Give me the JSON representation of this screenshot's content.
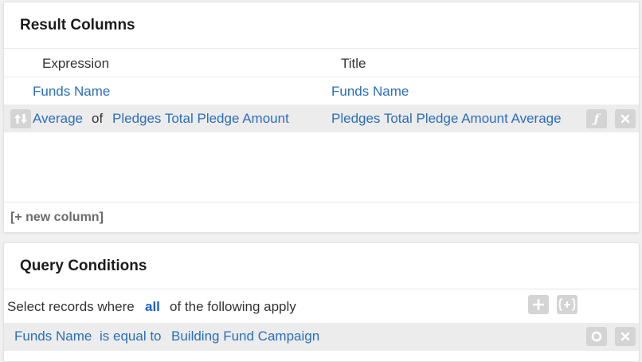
{
  "result_columns": {
    "title": "Result Columns",
    "headers": {
      "expression": "Expression",
      "title": "Title"
    },
    "rows": [
      {
        "expression": "Funds Name",
        "title": "Funds Name"
      },
      {
        "aggregate": "Average",
        "of": "of",
        "field": "Pledges Total Pledge Amount",
        "title": "Pledges Total Pledge Amount Average"
      }
    ],
    "new_column_label": "[+ new column]"
  },
  "query_conditions": {
    "title": "Query Conditions",
    "intro_prefix": "Select records where",
    "intro_match": "all",
    "intro_suffix": "of the following apply",
    "condition": {
      "field": "Funds Name",
      "operator": "is equal to",
      "value": "Building Fund Campaign"
    }
  },
  "icons": {
    "sort": "sort-arrows-icon",
    "function": "function-icon",
    "remove": "close-icon",
    "add": "plus-icon",
    "add_group": "brace-group-icon",
    "toggle": "circle-icon"
  }
}
